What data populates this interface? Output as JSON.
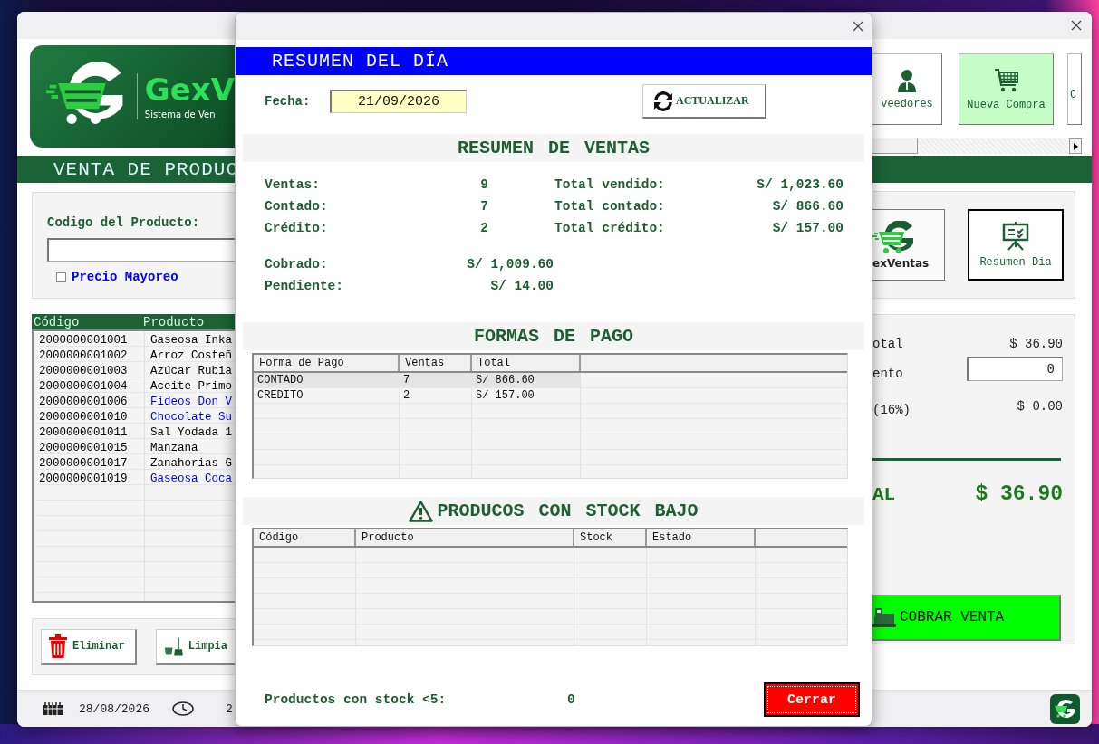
{
  "main_window": {
    "logo": {
      "name": "GexV",
      "tagline": "Sistema de Ven"
    },
    "toolbar": [
      {
        "label": "veedores",
        "kind": "person",
        "selected": false
      },
      {
        "label": "Nueva Compra",
        "kind": "cart",
        "selected": true
      },
      {
        "label": "C",
        "selected": false
      }
    ],
    "banner": "VENTA DE PRODUC",
    "product_code": {
      "label": "Codigo del Producto:"
    },
    "wholesale_price": {
      "label": "Precio Mayoreo",
      "checked": false
    },
    "cart_table": {
      "columns": [
        "Código",
        "Producto"
      ],
      "rows": [
        {
          "code": "2000000001001",
          "product": "Gaseosa Inka",
          "color": "#000000"
        },
        {
          "code": "2000000001002",
          "product": "Arroz Costeñ",
          "color": "#000000"
        },
        {
          "code": "2000000001003",
          "product": "Azúcar Rubia",
          "color": "#000000"
        },
        {
          "code": "2000000001004",
          "product": "Aceite Primo",
          "color": "#000000"
        },
        {
          "code": "2000000001006",
          "product": "Fideos Don V",
          "color": "#0000ff"
        },
        {
          "code": "2000000001010",
          "product": "Chocolate Su",
          "color": "#0000ff"
        },
        {
          "code": "2000000001011",
          "product": "Sal Yodada 1",
          "color": "#000000"
        },
        {
          "code": "2000000001015",
          "product": "Manzana",
          "color": "#000000"
        },
        {
          "code": "2000000001017",
          "product": "Zanahorias G",
          "color": "#000000"
        },
        {
          "code": "2000000001019",
          "product": "Gaseosa Coca",
          "color": "#0000ff"
        }
      ]
    },
    "actions": [
      {
        "label": "Eliminar",
        "kind": "trash"
      },
      {
        "label": "Limpia",
        "kind": "broom"
      }
    ],
    "status_bar": {
      "date": "28/08/2026",
      "time": "2"
    },
    "side_actions": [
      {
        "kind": "logo",
        "label": "exVentas"
      },
      {
        "kind": "summary",
        "label": "Resumen Dia"
      }
    ],
    "totals": {
      "subtotal_label": "otal",
      "subtotal": "$ 36.90",
      "discount_label": "ento",
      "discount": "0",
      "tax_label": "(16%)",
      "tax": "$ 0.00",
      "total_label": "AL",
      "total": "$ 36.90"
    },
    "charge_button": "COBRAR VENTA"
  },
  "dialog": {
    "title": "RESUMEN DEL DÍA",
    "date_label": "Fecha:",
    "date": "21/09/2026",
    "refresh_button": "ACTUALIZAR",
    "sales_heading": "RESUMEN DE VENTAS",
    "stats": [
      {
        "label": "Ventas:",
        "value": "9"
      },
      {
        "label": "Contado:",
        "value": "7"
      },
      {
        "label": "Crédito:",
        "value": "2"
      }
    ],
    "totals": [
      {
        "label": "Total vendido:",
        "value": "S/ 1,023.60"
      },
      {
        "label": "Total contado:",
        "value": "S/ 866.60"
      },
      {
        "label": "Total crédito:",
        "value": "S/ 157.00"
      }
    ],
    "balances": [
      {
        "label": "Cobrado:",
        "value": "S/ 1,009.60"
      },
      {
        "label": "Pendiente:",
        "value": "S/ 14.00"
      }
    ],
    "payments_heading": "FORMAS DE PAGO",
    "payments_table": {
      "columns": [
        "Forma de Pago",
        "Ventas",
        "Total"
      ],
      "rows": [
        {
          "cells": [
            "CONTADO",
            "7",
            "S/ 866.60"
          ],
          "selected": true
        },
        {
          "cells": [
            "CREDITO",
            "2",
            "S/ 157.00"
          ],
          "selected": false
        }
      ]
    },
    "low_stock_heading": "PRODUCOS CON STOCK BAJO",
    "low_stock_table": {
      "columns": [
        "Código",
        "Producto",
        "Stock",
        "Estado"
      ]
    },
    "low_stock_count_label": "Productos con stock <5:",
    "low_stock_count": "0",
    "close_button": "Cerrar"
  }
}
